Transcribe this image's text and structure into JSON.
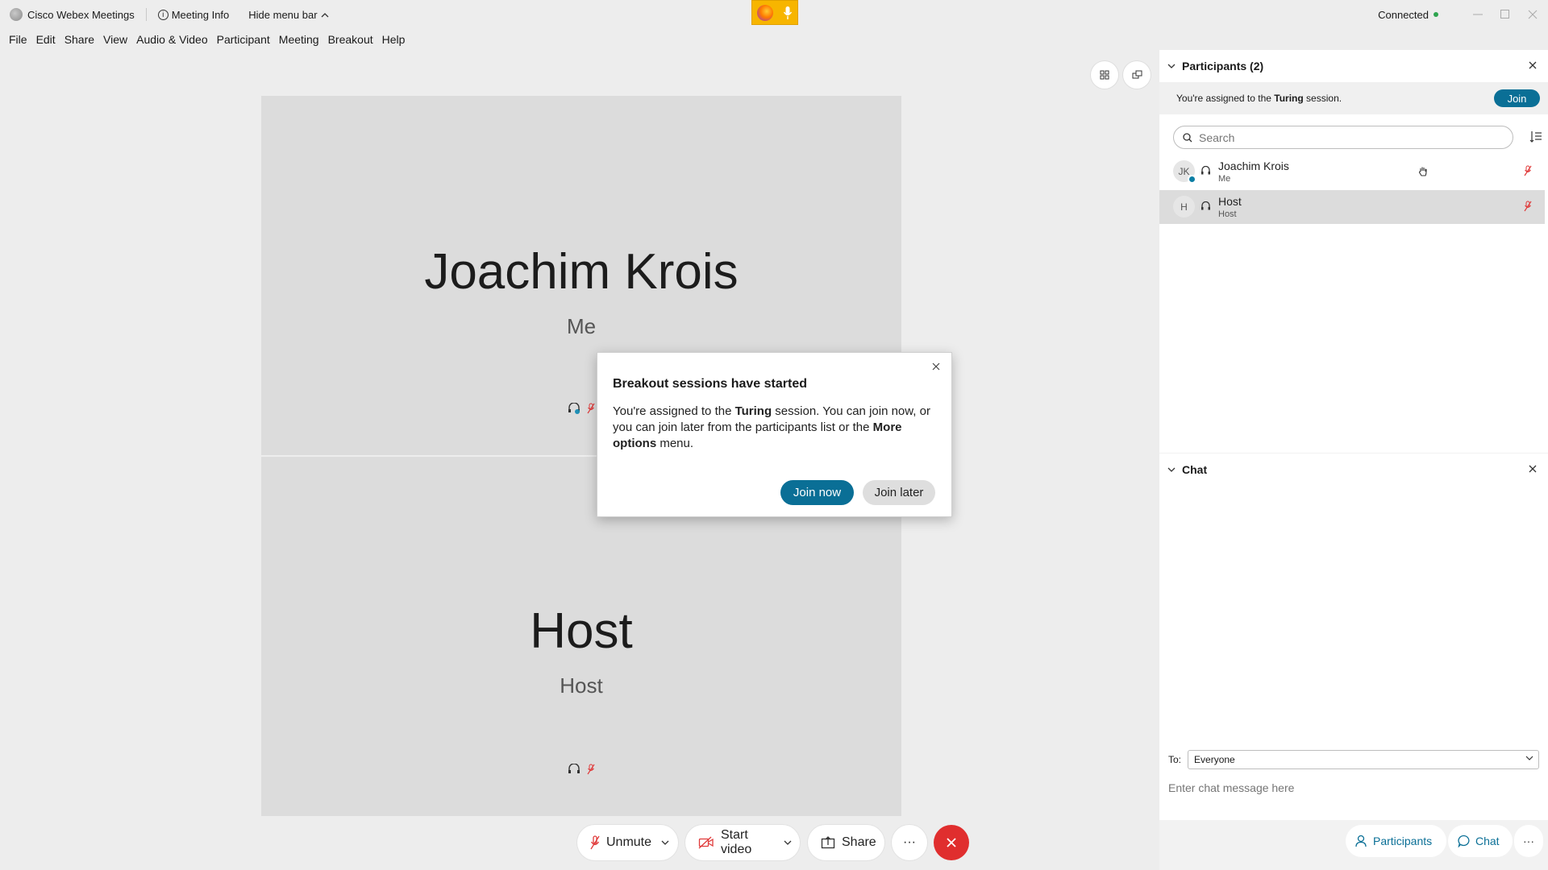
{
  "titlebar": {
    "app_name": "Cisco Webex Meetings",
    "meeting_info": "Meeting Info",
    "hide_menu": "Hide menu bar",
    "status": "Connected",
    "status_color": "#2ea44f",
    "indicator_color": "#f7b500"
  },
  "menu": {
    "items": [
      "File",
      "Edit",
      "Share",
      "View",
      "Audio & Video",
      "Participant",
      "Meeting",
      "Breakout",
      "Help"
    ]
  },
  "stage": {
    "tiles": [
      {
        "name": "Joachim Krois",
        "sub": "Me"
      },
      {
        "name": "Host",
        "sub": "Host"
      }
    ]
  },
  "dialog": {
    "title": "Breakout sessions have started",
    "msg_1": "You're assigned to the ",
    "msg_session": "Turing",
    "msg_2": " session. You can join now, or you can join later from the participants list or the ",
    "msg_more": "More options",
    "msg_3": " menu.",
    "join_now": "Join now",
    "join_later": "Join later",
    "accent": "#0a6f96"
  },
  "controls": {
    "unmute": "Unmute",
    "start_video": "Start video",
    "share": "Share",
    "more": "···",
    "leave_color": "#e02e2e"
  },
  "participants": {
    "title": "Participants (2)",
    "assigned_1": "You're assigned to the ",
    "assigned_session": "Turing",
    "assigned_2": " session.",
    "join": "Join",
    "search_placeholder": "Search",
    "list": [
      {
        "initials": "JK",
        "name": "Joachim Krois",
        "role": "Me"
      },
      {
        "initials": "H",
        "name": "Host",
        "role": "Host"
      }
    ]
  },
  "chat": {
    "title": "Chat",
    "to_label": "To:",
    "to_value": "Everyone",
    "input_placeholder": "Enter chat message here"
  },
  "panel_tabs": {
    "participants": "Participants",
    "chat": "Chat",
    "more": "···"
  }
}
